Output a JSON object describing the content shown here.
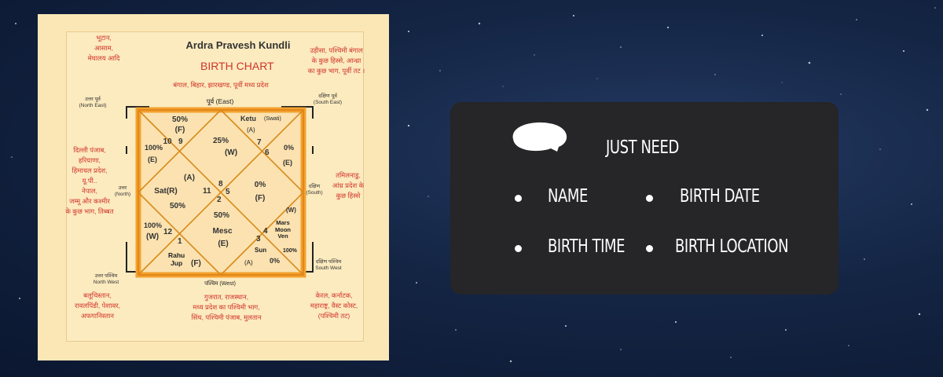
{
  "chart": {
    "title": "Ardra Pravesh Kundli",
    "subtitle": "BIRTH CHART",
    "top_region": "बंगाल, बिहार, झारखण्ड, पूर्वी मध्य प्रदेश",
    "direction_east": "पूर्व (East)",
    "direction_west": "पश्चिम (West)",
    "left_top_region": "भूटान,\nआसाम,\nमेघालय आदि",
    "right_top_region": "उड़ीसा, पश्चिमी बंगाल\nके कुछ हिस्से, आन्ध्रा\nका कुछ भाग, पूर्वी तट ।",
    "ne_label": "उत्तर पूर्व\n(North East)",
    "se_label": "दक्षिण पूर्व\n(South East)",
    "left_mid_region": "दिल्ली पंजाब,\nहरियाणा,\nहिमाचल प्रदेश,\nयू.पी..\nनेपाल,\nजम्मू और कश्मीर\nके कुछ भाग, तिब्बत",
    "north_label": "उत्तर\n(North)",
    "south_label": "दक्षिण\n(South)",
    "right_mid_region": "तमिलनाडु,\nआंध्र प्रदेश के\nकुछ हिस्से",
    "nw_label": "उत्तर पश्चिम\nNorth West",
    "sw_label": "दक्षिण पश्चिम\nSouth West",
    "left_bottom_region": "बलूचिस्तान,\nरावलपिंडी, पेशावर,\nअफगानिस्तान",
    "bottom_region": "गुजरात, राजस्थान,\nमध्य प्रदेश का पश्चिमी भाग,\nसिंध, पश्चिमी पंजाब, मुलतान",
    "right_bottom_region": "केरल, कर्नाटक,\nमहाराष्ट्र, वैस्ट कोस्ट,\n(पश्चिमी तट)",
    "houses": {
      "h1_pct": "50%",
      "h1_f": "(F)",
      "h1_nums": "10   9",
      "ketu": "Ketu",
      "swati": "(Swati)",
      "ketu_a": "(A)",
      "h7": "7",
      "h6": "6",
      "h_left_pct": "100%",
      "h_left_e": "(E)",
      "h_center_top": "25%",
      "h_center_top_w": "(W)",
      "h_right_pct": "0%",
      "h_right_e": "(E)",
      "h_a": "(A)",
      "sat": "Sat(R)",
      "sat_pct": "50%",
      "n11": "11",
      "n8": "8",
      "n5": "5",
      "n2": "2",
      "mid_right_pct": "0%",
      "mid_right_f": "(F)",
      "center_bottom_pct": "50%",
      "w_right": "(W)",
      "mars": "Mars\nMoon\nVen",
      "h100r": "100%",
      "bl_pct": "100%",
      "bl_w": "(W)",
      "n12": "12",
      "n1": "1",
      "mesc": "Mesc",
      "mesc_e": "(E)",
      "n3": "3",
      "n4": "4",
      "sun": "Sun",
      "sun_pct": "0%",
      "rahu": "Rahu\nJup",
      "rahu_f": "(F)",
      "bottom_a": "(A)"
    }
  },
  "info": {
    "heading": "JUST NEED",
    "items": [
      "NAME",
      "BIRTH DATE",
      "BIRTH TIME",
      "BIRTH LOCATION"
    ]
  },
  "colors": {
    "accent_red": "#d0342c",
    "chart_orange": "#f2a12e",
    "card_bg": "#262527"
  },
  "icons": [
    "speech-bubble-icon"
  ]
}
